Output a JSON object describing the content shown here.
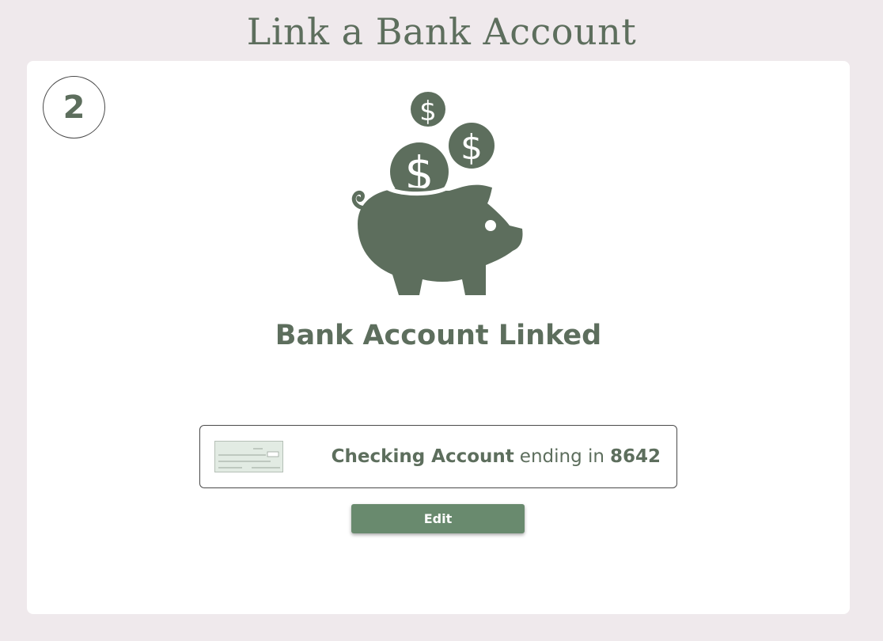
{
  "header": {
    "title": "Link a Bank Account"
  },
  "step": {
    "number": "2"
  },
  "illustration": {
    "icons": [
      "piggy-bank-icon",
      "dollar-coin-icon"
    ],
    "color": "#5d6e5d"
  },
  "status": {
    "heading": "Bank Account Linked"
  },
  "account": {
    "type": "Checking Account",
    "connector": "ending in",
    "last4": "8642",
    "thumbnail_icon": "check-image-icon"
  },
  "actions": {
    "edit_label": "Edit"
  },
  "colors": {
    "background": "#efe9ec",
    "card": "#ffffff",
    "text": "#5d6e5d",
    "button": "#698a6e"
  }
}
